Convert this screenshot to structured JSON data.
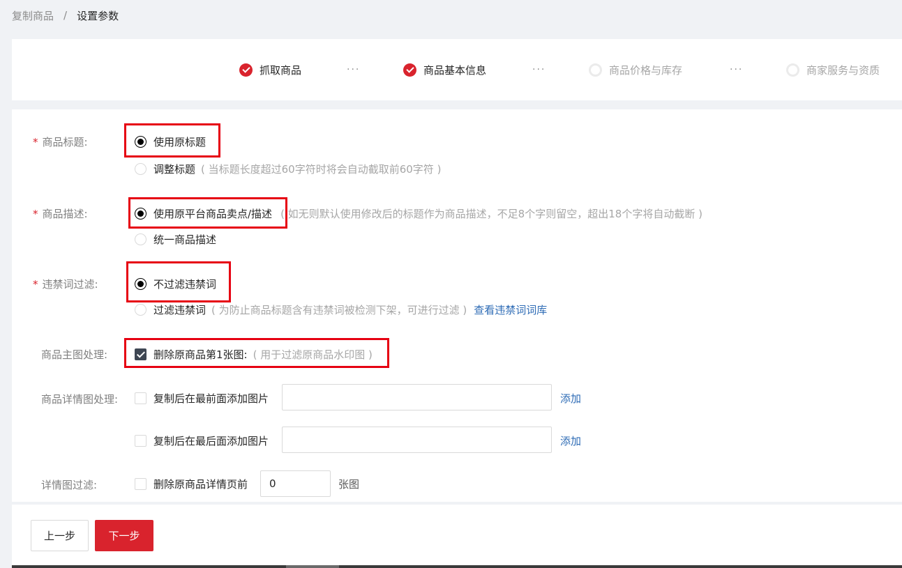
{
  "breadcrumb": {
    "parent": "复制商品",
    "separator": "/",
    "current": "设置参数"
  },
  "steps": [
    {
      "label": "抓取商品",
      "status": "done"
    },
    {
      "label": "商品基本信息",
      "status": "done"
    },
    {
      "label": "商品价格与库存",
      "status": "pending"
    },
    {
      "label": "商家服务与资质",
      "status": "pending"
    }
  ],
  "step_separator": "···",
  "form": {
    "title_row": {
      "label": "商品标题:",
      "required_mark": "*",
      "option_keep": "使用原标题",
      "option_adjust": "调整标题",
      "option_adjust_hint": "( 当标题长度超过60字符时将会自动截取前60字符 )",
      "selected": "keep"
    },
    "desc_row": {
      "label": "商品描述:",
      "required_mark": "*",
      "option_original": "使用原平台商品卖点/描述",
      "option_original_hint": "( 如无则默认使用修改后的标题作为商品描述，不足8个字则留空，超出18个字将自动截断 )",
      "option_unified": "统一商品描述",
      "selected": "original"
    },
    "filter_row": {
      "label": "违禁词过滤:",
      "required_mark": "*",
      "option_nofilter": "不过滤违禁词",
      "option_filter": "过滤违禁词",
      "option_filter_hint": "( 为防止商品标题含有违禁词被检测下架，可进行过滤 )",
      "view_link": "查看违禁词词库",
      "selected": "nofilter"
    },
    "main_image_row": {
      "label": "商品主图处理:",
      "option_delete_first": "删除原商品第1张图:",
      "option_delete_first_hint": "( 用于过滤原商品水印图 )",
      "checked": true
    },
    "detail_image_row": {
      "label": "商品详情图处理:",
      "option_front": "复制后在最前面添加图片",
      "front_input_value": "",
      "front_add_link": "添加",
      "option_back": "复制后在最后面添加图片",
      "back_input_value": "",
      "back_add_link": "添加",
      "front_checked": false,
      "back_checked": false
    },
    "detail_filter_row": {
      "label": "详情图过滤:",
      "option_delete_before": "删除原商品详情页前",
      "count_value": "0",
      "suffix": "张图",
      "checked": false
    }
  },
  "footer": {
    "prev_label": "上一步",
    "next_label": "下一步"
  },
  "colors": {
    "brand_red": "#d9232d",
    "highlight_box": "#e60012",
    "link_blue": "#2d6bb5",
    "checkbox_checked": "#3e4653"
  }
}
